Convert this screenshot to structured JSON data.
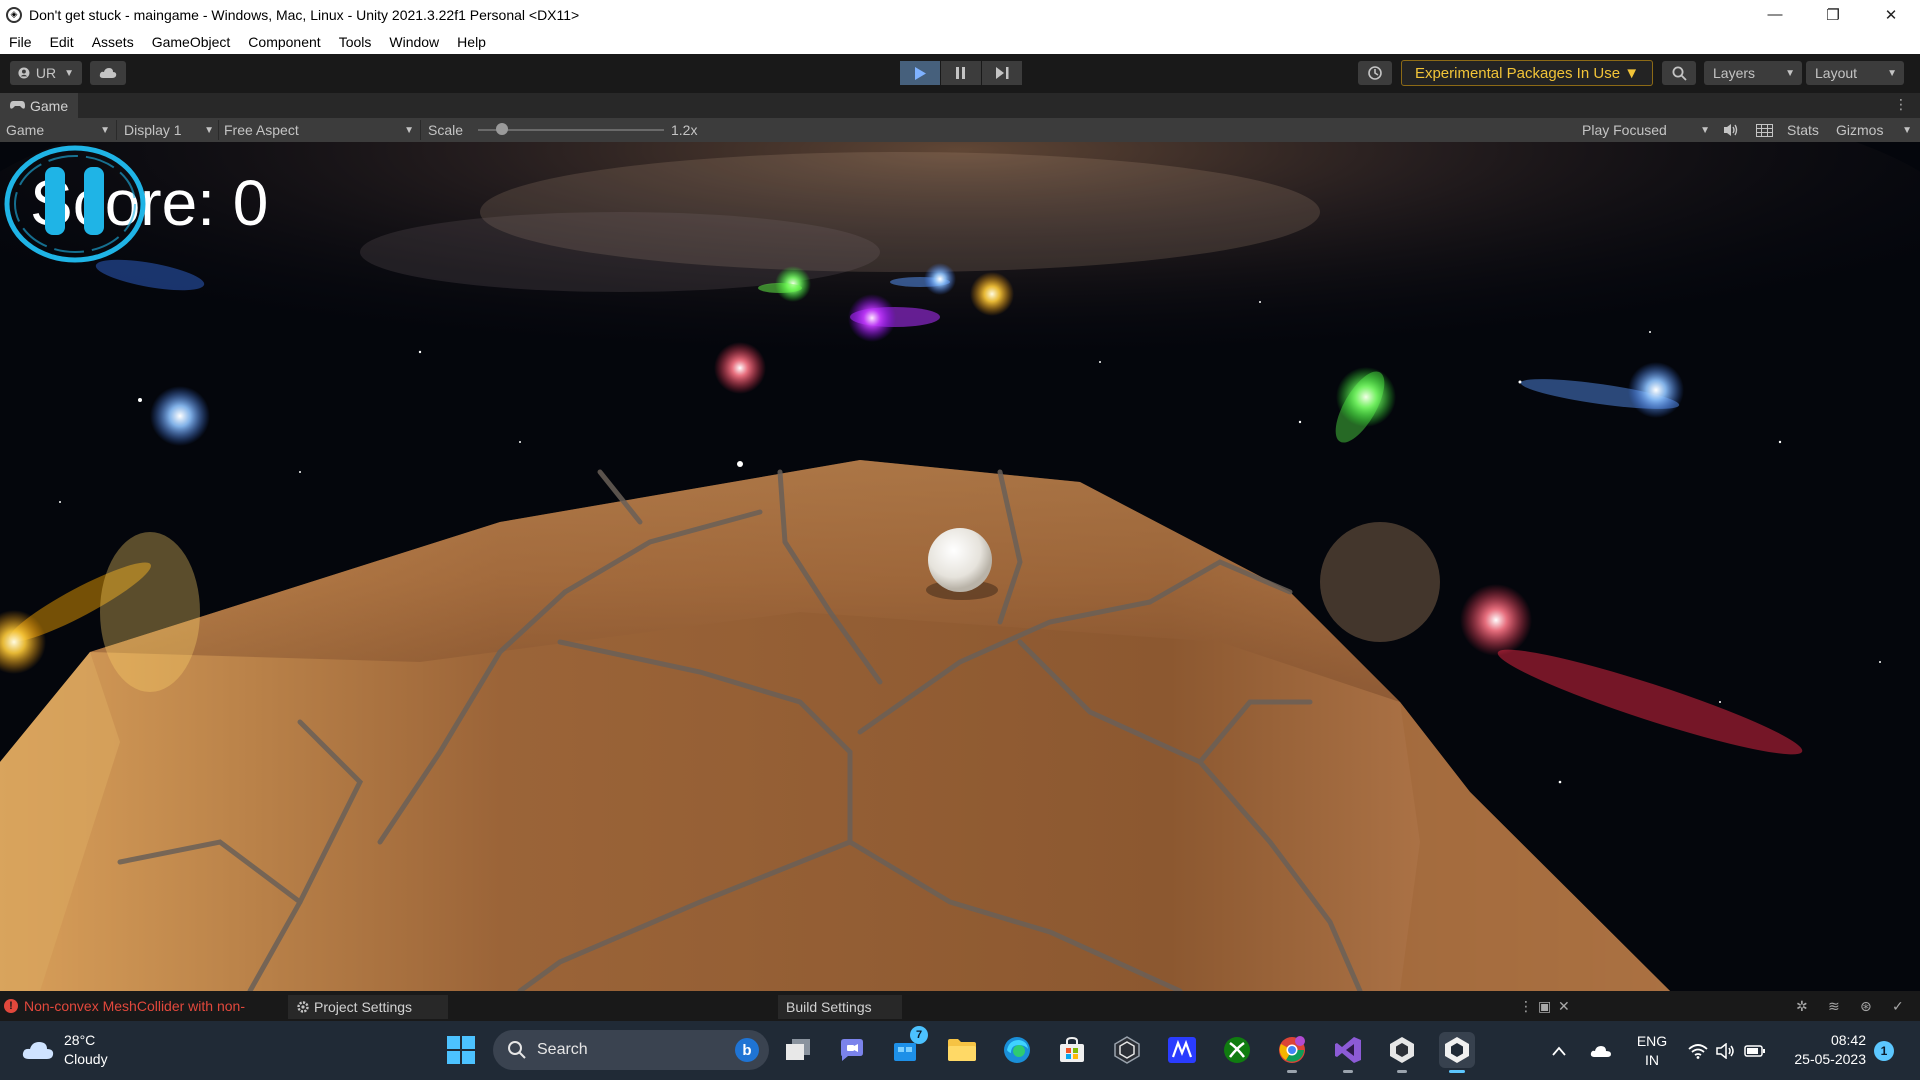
{
  "window": {
    "title": "Don't get stuck - maingame - Windows, Mac, Linux - Unity 2021.3.22f1 Personal <DX11>",
    "minimize": "—",
    "restore": "❐",
    "close": "✕"
  },
  "menu": [
    "File",
    "Edit",
    "Assets",
    "GameObject",
    "Component",
    "Tools",
    "Window",
    "Help"
  ],
  "toolbar": {
    "account_label": "UR",
    "experimental_label": "Experimental Packages In Use ▼",
    "layers_label": "Layers",
    "layout_label": "Layout",
    "play_state": "playing"
  },
  "game_tab": {
    "label": "Game"
  },
  "game_view": {
    "mode": "Game",
    "display": "Display 1",
    "aspect": "Free Aspect",
    "scale_label": "Scale",
    "scale_value": "1.2x",
    "play_focused": "Play Focused",
    "stats": "Stats",
    "gizmos": "Gizmos"
  },
  "game": {
    "score_text": "Score: 0"
  },
  "status": {
    "error_text": "Non-convex MeshCollider with non-",
    "project_settings": "Project Settings",
    "build_settings": "Build Settings"
  },
  "taskbar": {
    "weather_temp": "28°C",
    "weather_desc": "Cloudy",
    "search_label": "Search",
    "store_badge": "7",
    "lang_line1": "ENG",
    "lang_line2": "IN",
    "time": "08:42",
    "date": "25-05-2023",
    "notification_count": "1"
  },
  "colors": {
    "accent_warning": "#f2c438",
    "error": "#e2483c",
    "play_active": "#7fb2ff",
    "pause_button": "#1fb4e6"
  }
}
